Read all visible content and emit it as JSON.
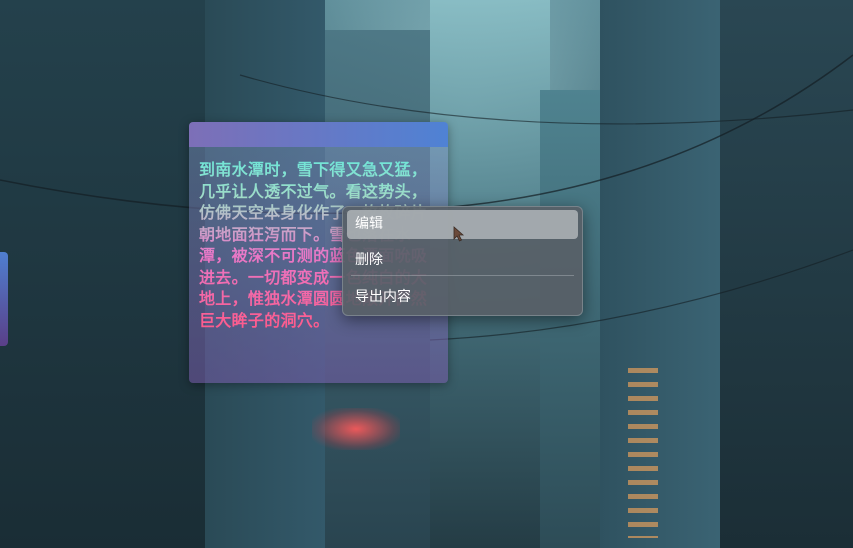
{
  "note": {
    "text": "到南水潭时，雪下得又急又猛，几乎让人透不过气。看这势头，仿佛天空本身化作了一枚枚碎片朝地面狂泻而下。雪也落在水潭，被深不可测的蓝色潭面吮吸进去。一切都变成一色纯白的大地上，惟独水潭圆圆地敞开俨然巨大眸子的洞穴。"
  },
  "context_menu": {
    "items": [
      {
        "label": "编辑",
        "highlighted": true
      },
      {
        "label": "删除"
      },
      {
        "label": "导出内容"
      }
    ]
  },
  "colors": {
    "titlebar_start": "#7d6fb7",
    "titlebar_end": "#4f82d4",
    "text_gradient_top": "#6fe6d8",
    "text_gradient_bottom": "#ff5a8a",
    "menu_bg": "#586067",
    "menu_highlight": "#afb5b9"
  },
  "icons": {
    "cursor": "mouse-pointer-icon"
  }
}
